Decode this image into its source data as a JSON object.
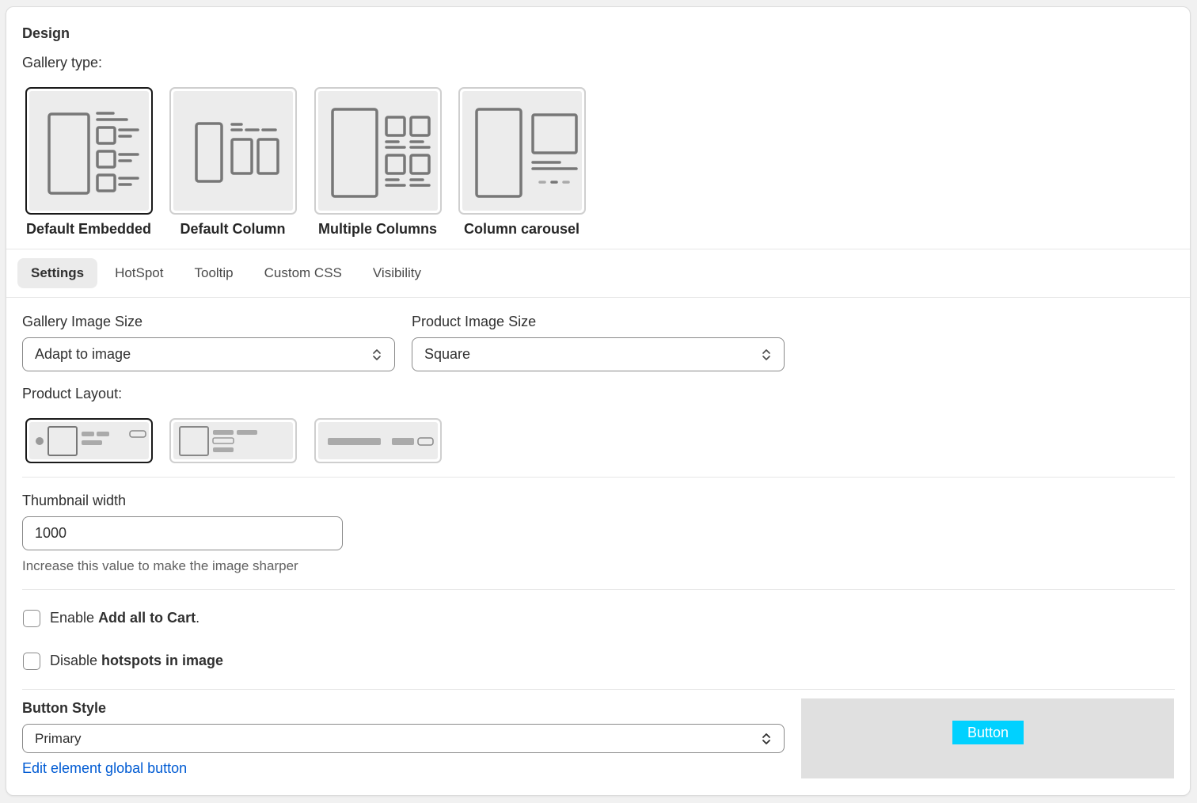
{
  "design": {
    "title": "Design",
    "gallery_type_label": "Gallery type:",
    "gallery_types": [
      {
        "label": "Default Embedded",
        "icon": "default-embedded-layout-icon",
        "selected": true
      },
      {
        "label": "Default Column",
        "icon": "default-column-layout-icon",
        "selected": false
      },
      {
        "label": "Multiple Columns",
        "icon": "multiple-columns-layout-icon",
        "selected": false
      },
      {
        "label": "Column carousel",
        "icon": "column-carousel-layout-icon",
        "selected": false
      }
    ]
  },
  "tabs": [
    {
      "label": "Settings",
      "active": true
    },
    {
      "label": "HotSpot",
      "active": false
    },
    {
      "label": "Tooltip",
      "active": false
    },
    {
      "label": "Custom CSS",
      "active": false
    },
    {
      "label": "Visibility",
      "active": false
    }
  ],
  "settings": {
    "gallery_image_size": {
      "label": "Gallery Image Size",
      "value": "Adapt to image"
    },
    "product_image_size": {
      "label": "Product Image Size",
      "value": "Square"
    },
    "product_layout": {
      "label": "Product Layout:",
      "options": [
        {
          "icon": "product-layout-inline-icon",
          "selected": true
        },
        {
          "icon": "product-layout-stacked-icon",
          "selected": false
        },
        {
          "icon": "product-layout-bar-icon",
          "selected": false
        }
      ]
    },
    "thumbnail_width": {
      "label": "Thumbnail width",
      "value": "1000",
      "help": "Increase this value to make the image sharper"
    },
    "add_all_to_cart": {
      "prefix": "Enable ",
      "bold": "Add all to Cart",
      "suffix": ".",
      "checked": false
    },
    "disable_hotspots": {
      "prefix": "Disable ",
      "bold": "hotspots in image",
      "checked": false
    },
    "button_style": {
      "label": "Button Style",
      "value": "Primary",
      "link": "Edit element global button",
      "preview_label": "Button",
      "preview_color": "#00d1ff",
      "preview_bg": "#e0e0e0"
    }
  }
}
